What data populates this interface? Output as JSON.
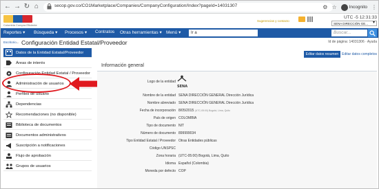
{
  "browser": {
    "url": "secop.gov.co/CO1Marketplace/Companies/CompanyConfiguration/Index?pageId=14031307",
    "incognito_label": "Incognito"
  },
  "header": {
    "logo_text": "Colombia Compra Eficiente",
    "header_link": "Sugerencias y contacto",
    "time": "UTC -5 12:31:33",
    "entity_select": "SENA DIRECCIÓN GE..."
  },
  "navbar": {
    "items": [
      "Reportes",
      "Búsqueda",
      "Procesos",
      "Contratos",
      "Otras herramientas",
      "Menú"
    ],
    "search_value": "Ir a",
    "buscar_placeholder": "Buscar..."
  },
  "breadcrumb": {
    "home": "Escritorio",
    "arrow": "→",
    "title": "Configuración Entidad Estatal/Proveedor",
    "help": "Id de página: 14031306 · Ayuda"
  },
  "sidebar": {
    "items": [
      {
        "label": "Datos de la Entidad Estatal/Proveedor",
        "icon": "building-icon"
      },
      {
        "label": "Áreas de interés",
        "icon": "tag-icon"
      },
      {
        "label": "Configuración Entidad Estatal / Proveedor",
        "icon": "gear-icon"
      },
      {
        "label": "Administración de usuarios",
        "icon": "user-admin-icon"
      },
      {
        "label": "Perfiles de usuario",
        "icon": "profile-icon"
      },
      {
        "label": "Dependencias",
        "icon": "org-chart-icon"
      },
      {
        "label": "Recomendaciones (no disponible)",
        "icon": "star-icon"
      },
      {
        "label": "Biblioteca de documentos",
        "icon": "library-icon"
      },
      {
        "label": "Documentos administrativos",
        "icon": "documents-icon"
      },
      {
        "label": "Suscripción a notificaciones",
        "icon": "megaphone-icon"
      },
      {
        "label": "Flujo de aprobación",
        "icon": "approval-icon"
      },
      {
        "label": "Grupos de usuarios",
        "icon": "users-group-icon"
      }
    ]
  },
  "main": {
    "edit_buttons": [
      "Editar datos resumen",
      "Editar datos completos"
    ],
    "section_title": "Información general",
    "logo_label": "Logo de la entidad",
    "logo_mark": "SENA",
    "rows": [
      {
        "label": "Nombre de la entidad",
        "value": "SENA DIRECCIÓN GENERAL Dirección Jurídica"
      },
      {
        "label": "Nombre abreviado",
        "value": "SENA DIRECCIÓN GENERAL Dirección Jurídica"
      },
      {
        "label": "Fecha de incorporación",
        "value": "8/05/2015",
        "note": "(UTC-05:00) Bogotá, Lima, Quito"
      },
      {
        "label": "País de origen",
        "value": "COLOMBIA"
      },
      {
        "label": "Tipo de documento",
        "value": "NIT"
      },
      {
        "label": "Número de documento",
        "value": "899999034"
      },
      {
        "label": "Tipo Entidad Estatal / Proveedor",
        "value": "Otras Entidades públicas"
      },
      {
        "label": "Código UNSPSC",
        "value": ""
      },
      {
        "label": "Zona horaria",
        "value": "(UTC-05:00) Bogotá, Lima, Quito"
      },
      {
        "label": "Idioma",
        "value": "Español (Colombia)"
      },
      {
        "label": "Moneda por defecto",
        "value": "COP"
      }
    ]
  },
  "colors": {
    "nav_blue": "#1e5aa6",
    "annotation_red": "#e0191f"
  }
}
